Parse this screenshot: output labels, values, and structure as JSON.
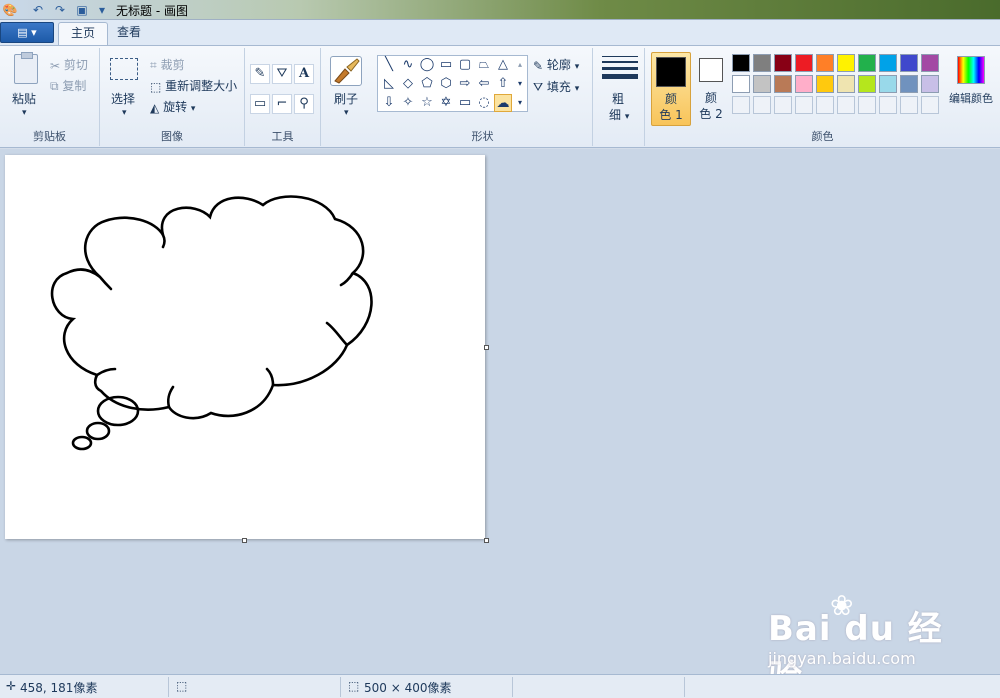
{
  "window": {
    "title": "无标题 - 画图"
  },
  "app_menu": {
    "label": "▤ ▾"
  },
  "tabs": [
    {
      "label": "主页",
      "active": true
    },
    {
      "label": "查看",
      "active": false
    }
  ],
  "ribbon": {
    "clipboard": {
      "label": "剪贴板",
      "paste": "粘贴",
      "cut": "剪切",
      "copy": "复制"
    },
    "image": {
      "label": "图像",
      "select": "选择",
      "crop": "裁剪",
      "resize": "重新调整大小",
      "rotate": "旋转"
    },
    "tools": {
      "label": "工具"
    },
    "brushes": {
      "label": "刷子"
    },
    "shapes": {
      "label": "形状",
      "outline": "轮廓",
      "fill": "填充"
    },
    "size": {
      "label_line1": "粗",
      "label_line2": "细"
    },
    "colors": {
      "label": "颜色",
      "color1_line1": "颜",
      "color1_line2": "色 1",
      "color2_line1": "颜",
      "color2_line2": "色 2",
      "edit": "编辑颜色",
      "color1": "#000000",
      "color2": "#ffffff",
      "palette_row1": [
        "#000000",
        "#7f7f7f",
        "#880015",
        "#ed1c24",
        "#ff7f27",
        "#fff200",
        "#22b14c",
        "#00a2e8",
        "#3f48cc",
        "#a349a4"
      ],
      "palette_row2": [
        "#ffffff",
        "#c3c3c3",
        "#b97a57",
        "#ffaec9",
        "#ffc90e",
        "#efe4b0",
        "#b5e61d",
        "#99d9ea",
        "#7092be",
        "#c8bfe7"
      ]
    }
  },
  "status": {
    "cursor_pos": "458, 181像素",
    "image_size": "500 × 400像素"
  },
  "watermark": {
    "main": "Bai du 经验",
    "sub": "jingyan.baidu.com"
  }
}
